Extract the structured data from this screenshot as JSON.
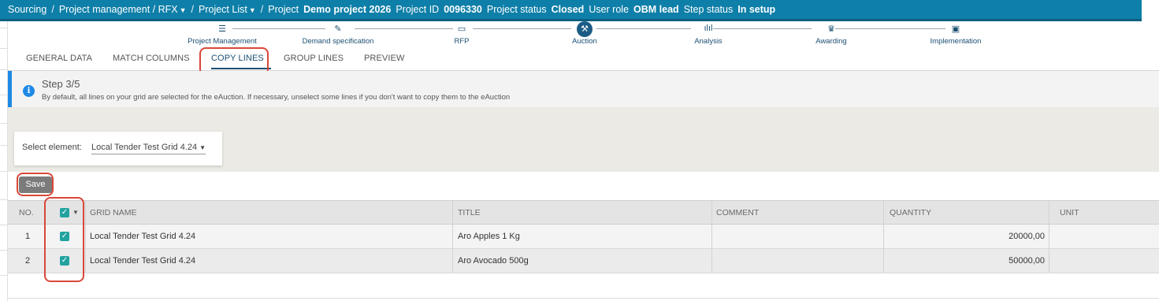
{
  "breadcrumb": {
    "root": "Sourcing",
    "module": "Project management / RFX",
    "list": "Project List",
    "project_label": "Project",
    "project_name": "Demo project 2026",
    "project_id_label": "Project ID",
    "project_id": "0096330",
    "status_label": "Project status",
    "status": "Closed",
    "role_label": "User role",
    "role": "OBM lead",
    "step_status_label": "Step status",
    "step_status": "In setup"
  },
  "steps": [
    {
      "label": "Project Management",
      "icon": "list-icon"
    },
    {
      "label": "Demand specification",
      "icon": "pencil-icon"
    },
    {
      "label": "RFP",
      "icon": "document-icon"
    },
    {
      "label": "Auction",
      "icon": "gavel-icon",
      "active": true
    },
    {
      "label": "Analysis",
      "icon": "bar-chart-icon"
    },
    {
      "label": "Awarding",
      "icon": "award-icon"
    },
    {
      "label": "Implementation",
      "icon": "chart-board-icon"
    }
  ],
  "tabs": [
    {
      "label": "GENERAL DATA"
    },
    {
      "label": "MATCH COLUMNS"
    },
    {
      "label": "COPY LINES",
      "active": true
    },
    {
      "label": "GROUP LINES"
    },
    {
      "label": "PREVIEW"
    }
  ],
  "info": {
    "title": "Step 3/5",
    "text": "By default, all lines on your grid are selected for the eAuction. If necessary, unselect some lines if you don't want to copy them to the eAuction",
    "icon_glyph": "i"
  },
  "select": {
    "label": "Select element:",
    "value": "Local Tender Test Grid 4.24"
  },
  "save_label": "Save",
  "table": {
    "headers": {
      "no": "NO.",
      "grid_name": "GRID NAME",
      "title": "TITLE",
      "comment": "COMMENT",
      "quantity": "QUANTITY",
      "unit": "UNIT"
    },
    "rows": [
      {
        "no": "1",
        "checked": true,
        "grid_name": "Local Tender Test Grid 4.24",
        "title": "Aro Apples 1 Kg",
        "comment": "",
        "quantity": "20000,00",
        "unit": ""
      },
      {
        "no": "2",
        "checked": true,
        "grid_name": "Local Tender Test Grid 4.24",
        "title": "Aro Avocado 500g",
        "comment": "",
        "quantity": "50000,00",
        "unit": ""
      }
    ]
  },
  "colors": {
    "topbar": "#0e7fa8",
    "accent": "#1b4f72",
    "info": "#1e88e5",
    "checkbox": "#22a3a0",
    "highlight": "#d9473a"
  }
}
